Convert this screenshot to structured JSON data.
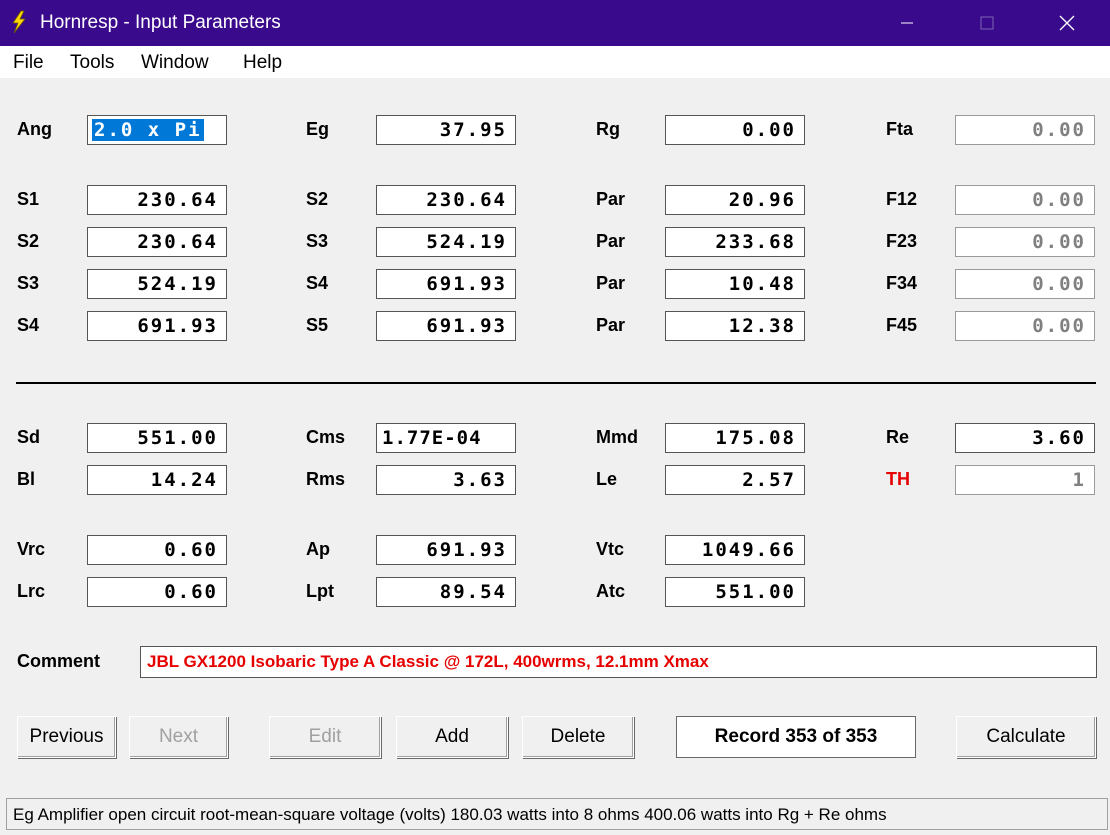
{
  "window": {
    "title": "Hornresp - Input Parameters"
  },
  "menu": {
    "file": "File",
    "tools": "Tools",
    "window": "Window",
    "help": "Help"
  },
  "top": {
    "ang_label": "Ang",
    "ang_value": "2.0 x Pi",
    "eg_label": "Eg",
    "eg_value": "37.95",
    "rg_label": "Rg",
    "rg_value": "0.00",
    "fta_label": "Fta",
    "fta_value": "0.00"
  },
  "segments": [
    {
      "l1": "S1",
      "v1": "230.64",
      "l2": "S2",
      "v2": "230.64",
      "l3": "Par",
      "v3": "20.96",
      "l4": "F12",
      "v4": "0.00"
    },
    {
      "l1": "S2",
      "v1": "230.64",
      "l2": "S3",
      "v2": "524.19",
      "l3": "Par",
      "v3": "233.68",
      "l4": "F23",
      "v4": "0.00"
    },
    {
      "l1": "S3",
      "v1": "524.19",
      "l2": "S4",
      "v2": "691.93",
      "l3": "Par",
      "v3": "10.48",
      "l4": "F34",
      "v4": "0.00"
    },
    {
      "l1": "S4",
      "v1": "691.93",
      "l2": "S5",
      "v2": "691.93",
      "l3": "Par",
      "v3": "12.38",
      "l4": "F45",
      "v4": "0.00"
    }
  ],
  "driver": {
    "sd_label": "Sd",
    "sd_value": "551.00",
    "cms_label": "Cms",
    "cms_value": "1.77E-04",
    "mmd_label": "Mmd",
    "mmd_value": "175.08",
    "re_label": "Re",
    "re_value": "3.60",
    "bl_label": "Bl",
    "bl_value": "14.24",
    "rms_label": "Rms",
    "rms_value": "3.63",
    "le_label": "Le",
    "le_value": "2.57",
    "th_label": "TH",
    "th_value": "1"
  },
  "chamber": {
    "vrc_label": "Vrc",
    "vrc_value": "0.60",
    "ap_label": "Ap",
    "ap_value": "691.93",
    "vtc_label": "Vtc",
    "vtc_value": "1049.66",
    "lrc_label": "Lrc",
    "lrc_value": "0.60",
    "lpt_label": "Lpt",
    "lpt_value": "89.54",
    "atc_label": "Atc",
    "atc_value": "551.00"
  },
  "comment": {
    "label": "Comment",
    "value": "JBL GX1200 Isobaric Type A Classic @ 172L, 400wrms, 12.1mm Xmax"
  },
  "buttons": {
    "previous": "Previous",
    "next": "Next",
    "edit": "Edit",
    "add": "Add",
    "delete": "Delete",
    "record": "Record 353 of 353",
    "calculate": "Calculate"
  },
  "status": "Eg  Amplifier open circuit root-mean-square voltage  (volts)   180.03 watts into 8 ohms   400.06 watts into Rg + Re ohms"
}
